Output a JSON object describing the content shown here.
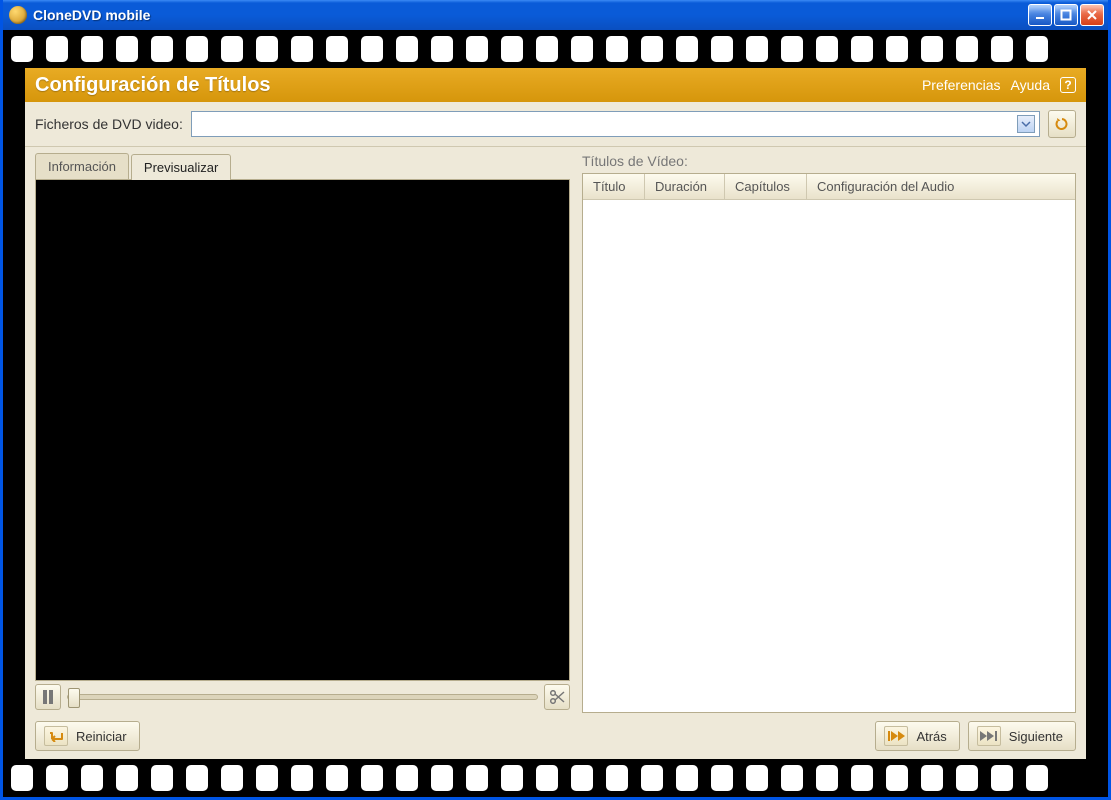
{
  "window": {
    "title": "CloneDVD mobile"
  },
  "header": {
    "title": "Configuración de Títulos",
    "links": {
      "prefs": "Preferencias",
      "help": "Ayuda",
      "help_q": "?"
    }
  },
  "path": {
    "label": "Ficheros de DVD video:",
    "value": ""
  },
  "tabs": {
    "info": "Información",
    "preview": "Previsualizar",
    "active": "preview"
  },
  "video_titles": {
    "label": "Títulos de Vídeo:",
    "columns": {
      "title": "Título",
      "duration": "Duración",
      "chapters": "Capítulos",
      "audio": "Configuración del Audio"
    }
  },
  "buttons": {
    "restart": "Reiniciar",
    "back": "Atrás",
    "next": "Siguiente"
  }
}
